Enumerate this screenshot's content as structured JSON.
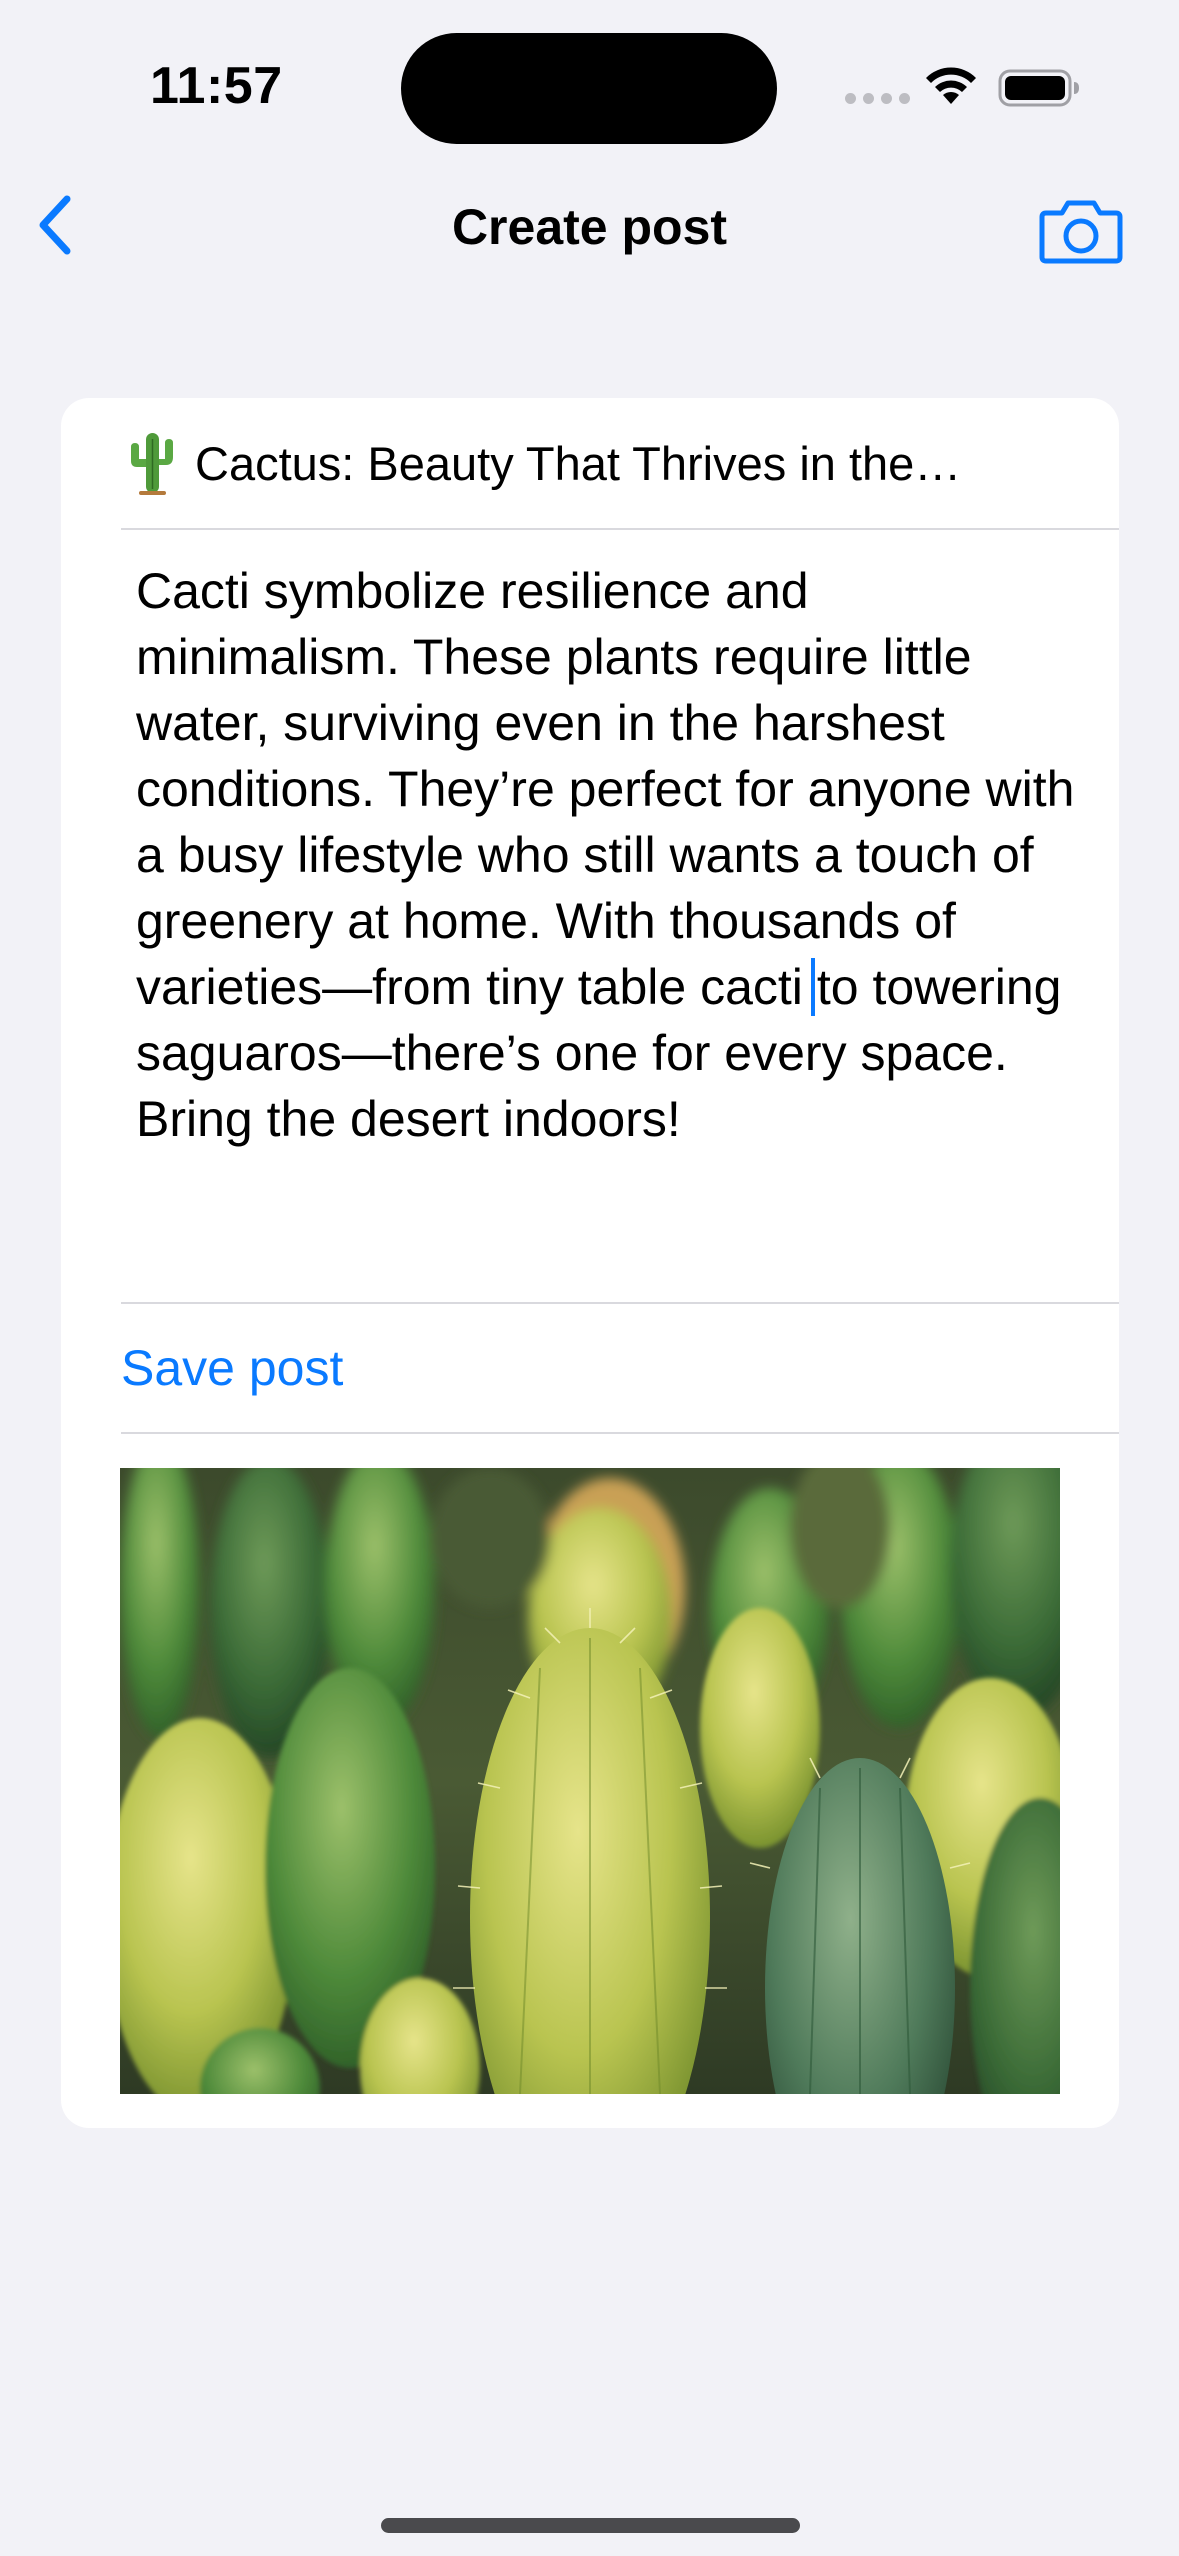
{
  "status_bar": {
    "time": "11:57"
  },
  "nav": {
    "title": "Create post",
    "back_icon": "chevron-left-icon",
    "camera_icon": "camera-icon"
  },
  "post": {
    "title": "Cactus: Beauty That Thrives in the…",
    "body_before_cursor": "Cacti symbolize resilience and minimalism. These plants require little water, surviving even in the harshest conditions. They’re perfect for anyone with a busy lifestyle who still wants a touch of greenery at home. With thousands of varieties—from tiny table cacti",
    "body_after_cursor": "to towering saguaros—there’s one for every space. Bring the desert indoors!",
    "save_label": "Save post",
    "photo_subject": "cactus-photo"
  },
  "colors": {
    "accent": "#0a7aff",
    "background": "#f2f2f7",
    "card": "#ffffff",
    "divider": "#d9d9de"
  }
}
